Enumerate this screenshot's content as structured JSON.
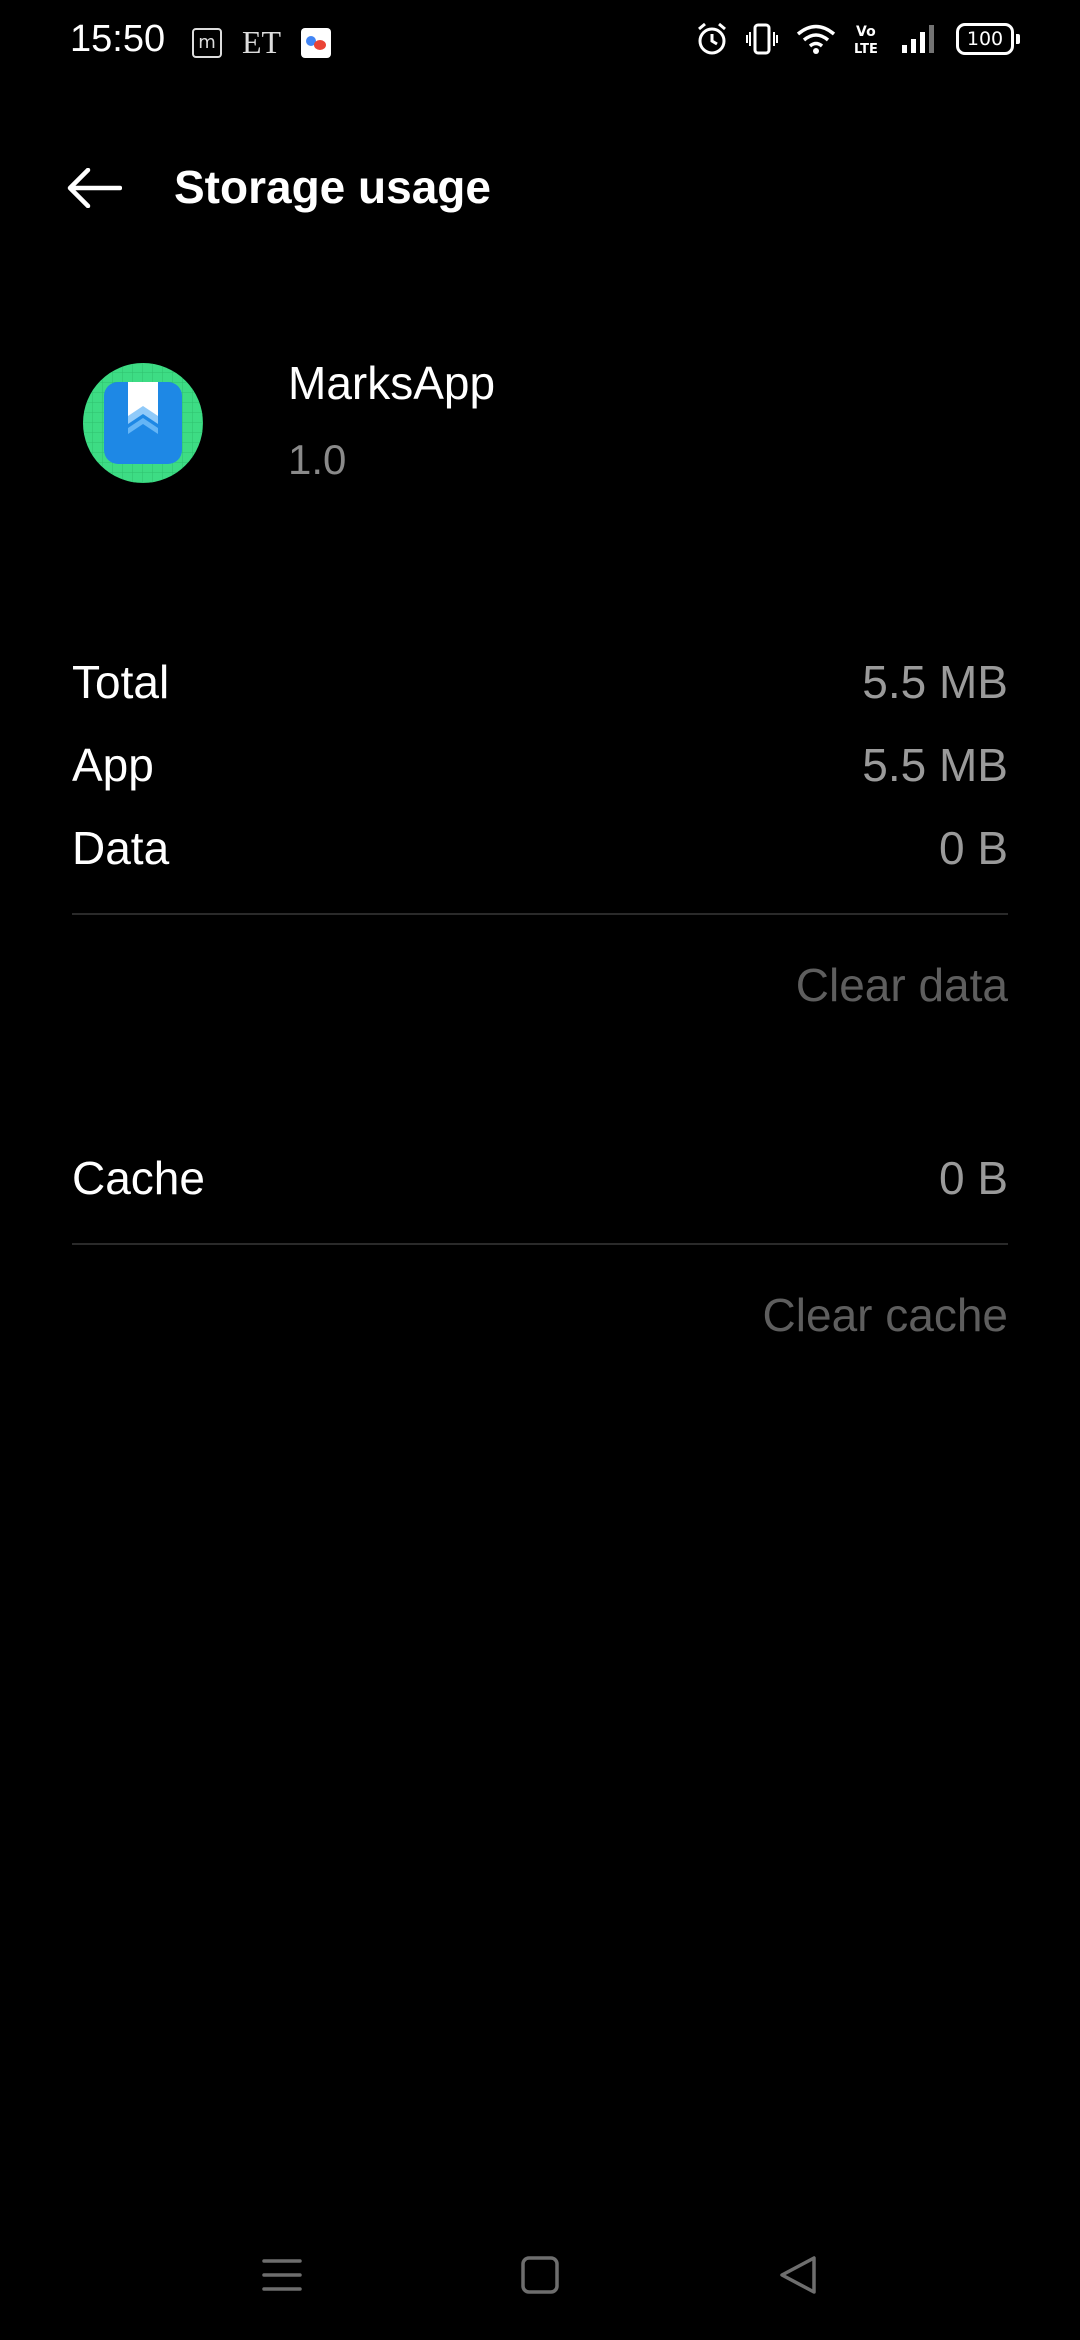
{
  "status_bar": {
    "time": "15:50",
    "notif_m": "m",
    "notif_et": "ET",
    "battery": "100",
    "volte_top": "Vo",
    "volte_bottom": "LTE"
  },
  "header": {
    "title": "Storage usage"
  },
  "app": {
    "name": "MarksApp",
    "version": "1.0"
  },
  "storage": {
    "total_label": "Total",
    "total_value": "5.5 MB",
    "app_label": "App",
    "app_value": "5.5 MB",
    "data_label": "Data",
    "data_value": "0 B",
    "clear_data": "Clear data",
    "cache_label": "Cache",
    "cache_value": "0 B",
    "clear_cache": "Clear cache"
  },
  "icons": {
    "back": "arrow-left-icon",
    "app": "bookmark-app-icon",
    "nav_menu": "menu-icon",
    "nav_home": "square-icon",
    "nav_back": "triangle-back-icon"
  },
  "colors": {
    "background": "#000000",
    "primary_text": "#ffffff",
    "secondary_text": "#9a9a9a",
    "disabled_action": "#5e5e5e",
    "app_icon_bg": "#3ddc84",
    "app_icon_fg": "#1e88e5"
  }
}
